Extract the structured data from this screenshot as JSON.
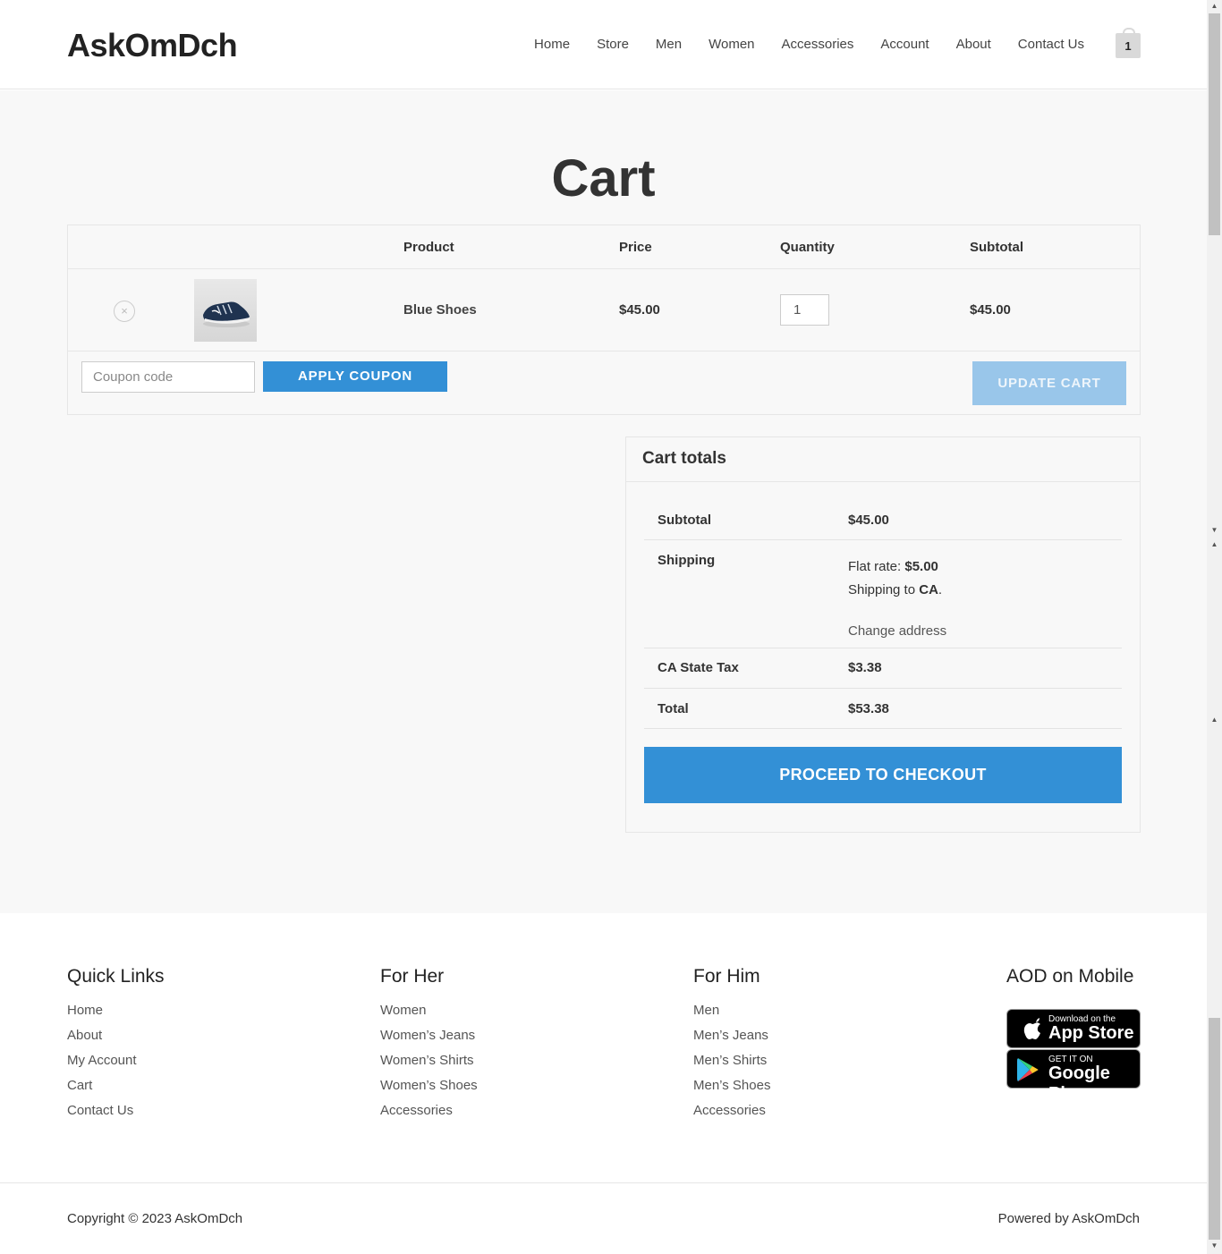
{
  "header": {
    "logo": "AskOmDch",
    "nav": [
      "Home",
      "Store",
      "Men",
      "Women",
      "Accessories",
      "Account",
      "About",
      "Contact Us"
    ],
    "cart_count": "1"
  },
  "page": {
    "title": "Cart"
  },
  "cart": {
    "columns": [
      "Product",
      "Price",
      "Quantity",
      "Subtotal"
    ],
    "items": [
      {
        "remove": "×",
        "name": "Blue Shoes",
        "price": "$45.00",
        "quantity": "1",
        "subtotal": "$45.00"
      }
    ],
    "coupon_placeholder": "Coupon code",
    "apply_coupon": "APPLY COUPON",
    "update_cart": "UPDATE CART"
  },
  "totals": {
    "title": "Cart totals",
    "subtotal_label": "Subtotal",
    "subtotal_value": "$45.00",
    "shipping_label": "Shipping",
    "flat_rate_text": "Flat rate: ",
    "flat_rate_value": "$5.00",
    "shipping_to_text": "Shipping to ",
    "shipping_to_value": "CA",
    "shipping_to_suffix": ".",
    "change_address": "Change address",
    "tax_label": "CA State Tax",
    "tax_value": "$3.38",
    "total_label": "Total",
    "total_value": "$53.38",
    "checkout": "PROCEED TO CHECKOUT"
  },
  "footer": {
    "quick_links": {
      "title": "Quick Links",
      "links": [
        "Home",
        "About",
        "My Account",
        "Cart",
        "Contact Us"
      ]
    },
    "for_her": {
      "title": "For Her",
      "links": [
        "Women",
        "Women’s Jeans",
        "Women’s Shirts",
        "Women’s Shoes",
        "Accessories"
      ]
    },
    "for_him": {
      "title": "For Him",
      "links": [
        "Men",
        "Men’s Jeans",
        "Men’s Shirts",
        "Men’s Shoes",
        "Accessories"
      ]
    },
    "mobile": {
      "title": "AOD on Mobile",
      "app_store_small": "Download on the",
      "app_store_big": "App Store",
      "google_play_small": "GET IT ON",
      "google_play_big": "Google Play"
    },
    "copyright": "Copyright © 2023 AskOmDch",
    "powered_by": "Powered by AskOmDch"
  },
  "colors": {
    "accent": "#3390d6",
    "accent_light": "#99c6ea",
    "background": "#f8f8f8"
  },
  "icons": [
    "remove-icon",
    "cart-icon",
    "apple-icon",
    "google-play-icon"
  ]
}
